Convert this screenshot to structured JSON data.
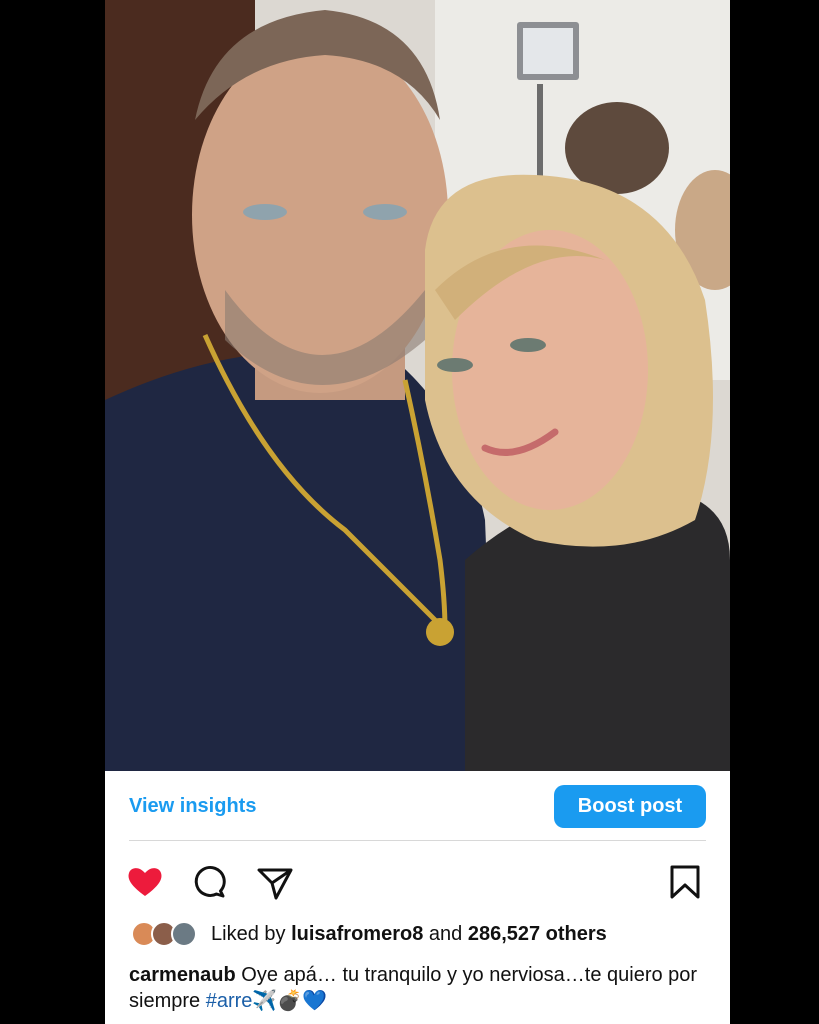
{
  "post": {
    "photo_alt": "",
    "view_insights_label": "View insights",
    "boost_label": "Boost post",
    "liked_prefix": "Liked by",
    "liked_user": "luisafromero8",
    "liked_and": "and",
    "liked_count": "286,527 others",
    "caption_user": "carmenaub",
    "caption_text": "Oye apá… tu tranquilo y yo nerviosa…te quiero por siempre",
    "caption_hashtag": "#arre",
    "caption_emoji": "✈️💣💙",
    "accent_color": "#1a9bf0",
    "like_color": "#ed1b3c",
    "icons": [
      "heart-icon",
      "comment-icon",
      "share-icon",
      "bookmark-icon"
    ]
  }
}
